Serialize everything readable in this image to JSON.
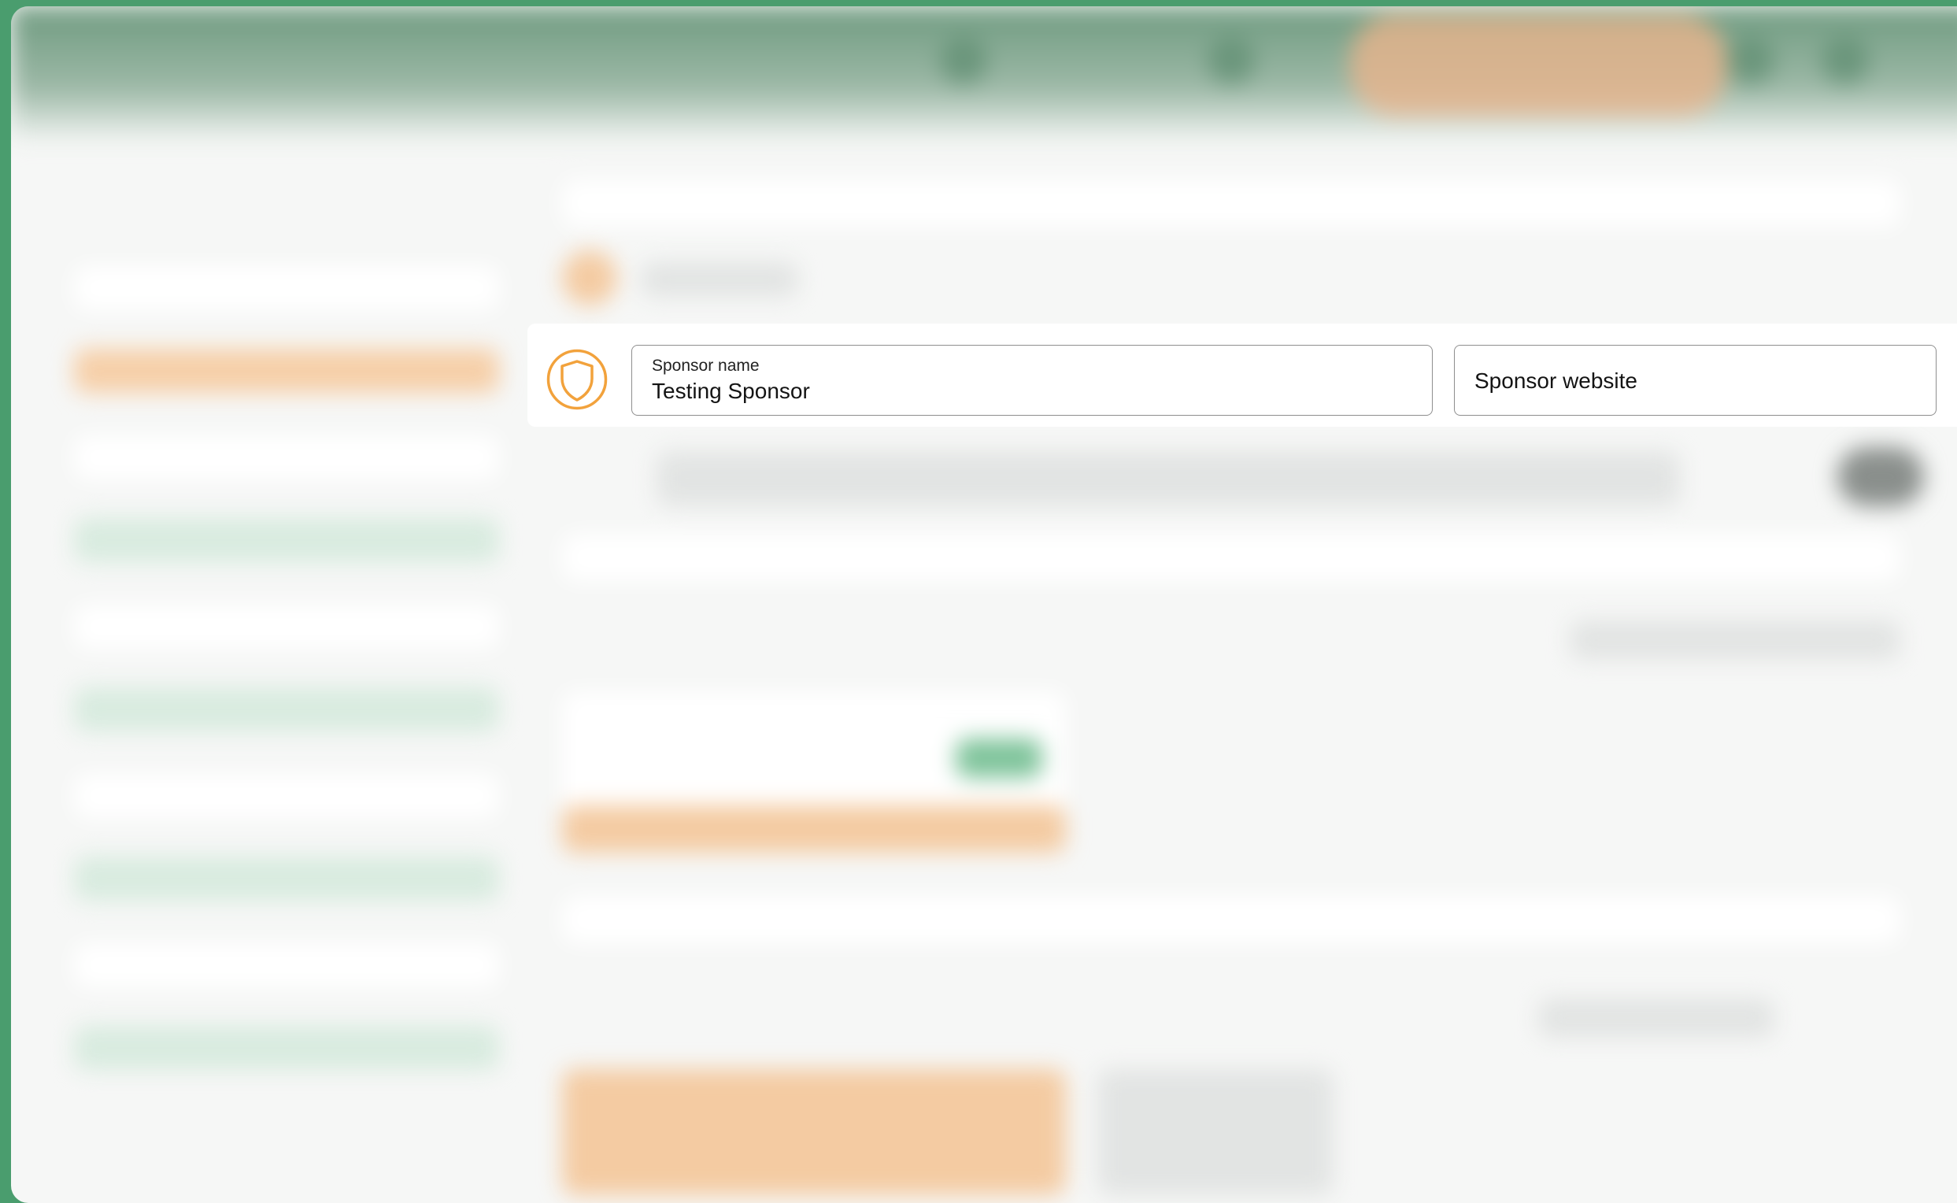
{
  "sponsor_form": {
    "icon": "shield-icon",
    "accent_color": "#f2a23c",
    "name_field": {
      "label": "Sponsor name",
      "value": "Testing Sponsor"
    },
    "website_field": {
      "placeholder": "Sponsor website",
      "value": ""
    }
  },
  "colors": {
    "desktop": "#4a9d6e",
    "overlay_background": "#f6f7f6",
    "field_border": "#8e8e8e"
  }
}
